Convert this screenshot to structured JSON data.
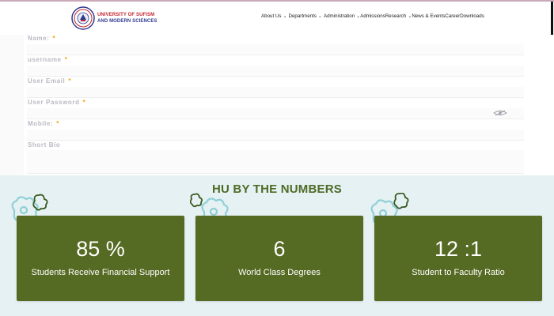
{
  "header": {
    "logo": {
      "line1": "UNIVERSITY OF SUFISM",
      "line2": "AND MODERN SCIENCES"
    },
    "nav": [
      {
        "label": "About Us",
        "dropdown": true
      },
      {
        "label": "Departments",
        "dropdown": true
      },
      {
        "label": "Administration",
        "dropdown": true
      },
      {
        "label": "Admissions",
        "dropdown": false
      },
      {
        "label": "Research",
        "dropdown": true
      },
      {
        "label": "News & Events",
        "dropdown": false
      },
      {
        "label": "Career",
        "dropdown": false
      },
      {
        "label": "Downloads",
        "dropdown": false
      }
    ]
  },
  "form": {
    "fields": [
      {
        "label": "Name:",
        "required": true,
        "value": ""
      },
      {
        "label": "username",
        "required": true,
        "value": ""
      },
      {
        "label": "User Email",
        "required": true,
        "value": ""
      },
      {
        "label": "User Password",
        "required": true,
        "value": ""
      },
      {
        "label": "Mobile:",
        "required": true,
        "value": ""
      },
      {
        "label": "Short Bio",
        "required": false,
        "value": ""
      }
    ],
    "required_marker": "*"
  },
  "numbers": {
    "title": "HU BY THE NUMBERS",
    "stats": [
      {
        "value": "85 %",
        "label": "Students Receive Financial Support"
      },
      {
        "value": "6",
        "label": "World Class Degrees"
      },
      {
        "value": "12 :1",
        "label": "Student to Faculty Ratio"
      }
    ]
  },
  "colors": {
    "accent_green": "#556a22",
    "title_green": "#4e6b26",
    "section_bg": "#e5f1f3",
    "required_star": "#f2a20c",
    "logo_red": "#c4252e",
    "logo_blue": "#2f3a8e"
  },
  "icons": {
    "password_toggle": "eye-slash-icon",
    "stat_decoration": "flower-doodle-icon"
  }
}
